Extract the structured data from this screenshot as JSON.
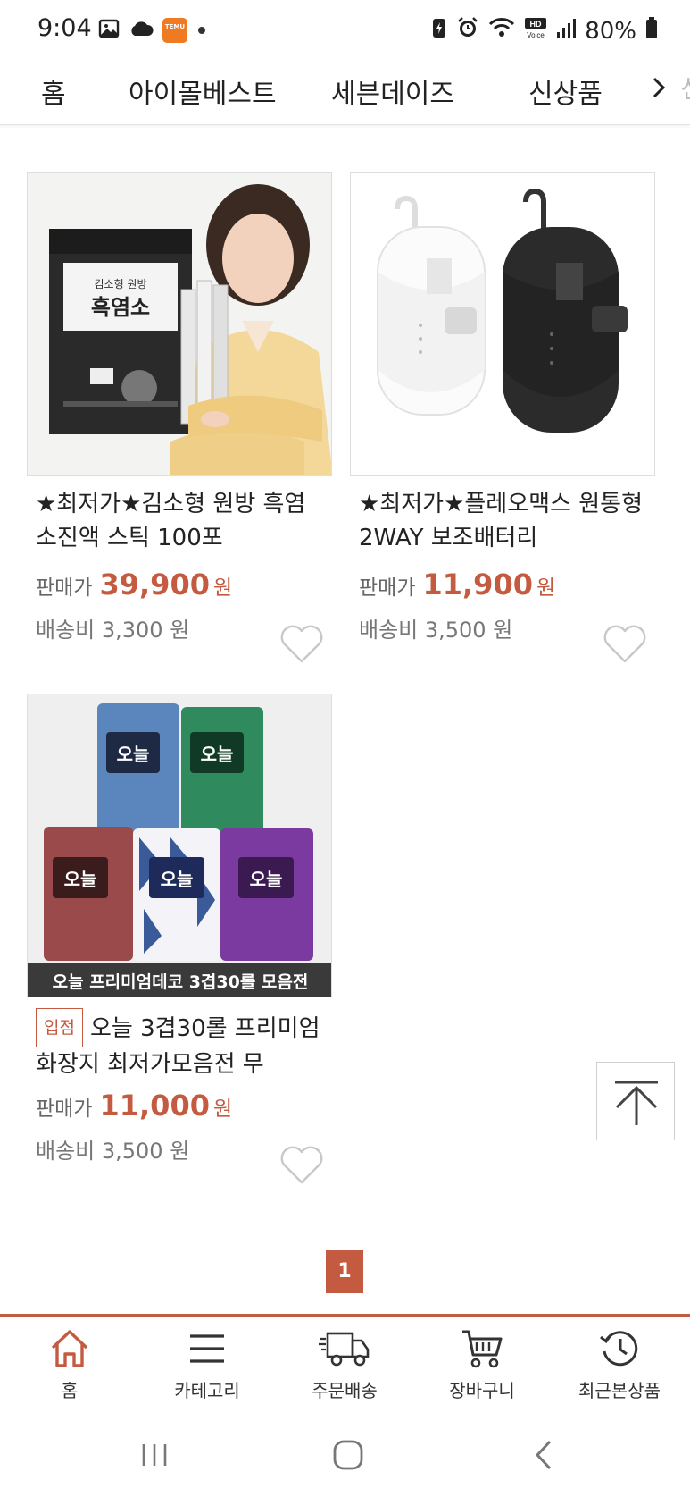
{
  "status_bar": {
    "time": "9:04",
    "battery": "80%",
    "app_badge": "TEMU"
  },
  "category_nav": {
    "items": [
      "홈",
      "아이몰베스트",
      "세븐데이즈",
      "신상품"
    ],
    "more_label": "신",
    "more_icon": "chevron-right-icon"
  },
  "products": [
    {
      "title": "★최저가★김소형 원방 흑염소진액 스틱 100포",
      "price_label": "판매가",
      "price": "39,900",
      "currency": "원",
      "shipping": "배송비 3,300 원",
      "image_text_1": "김소형 원방",
      "image_text_2": "흑염소"
    },
    {
      "title": "★최저가★플레오맥스 원통형 2WAY 보조배터리",
      "price_label": "판매가",
      "price": "11,900",
      "currency": "원",
      "shipping": "배송비 3,500 원"
    },
    {
      "badge": "입점",
      "title": "오늘 3겹30롤 프리미엄화장지 최저가모음전 무",
      "price_label": "판매가",
      "price": "11,000",
      "currency": "원",
      "shipping": "배송비 3,500 원",
      "image_caption": "오늘 프리미엄데코 3겹30롤 모음전",
      "pack_brand": "오늘"
    }
  ],
  "pagination": {
    "current": "1"
  },
  "bottom_nav": {
    "items": [
      "홈",
      "카테고리",
      "주문배송",
      "장바구니",
      "최근본상품"
    ]
  },
  "colors": {
    "accent": "#c45a3f",
    "text": "#222222",
    "muted": "#777777"
  }
}
